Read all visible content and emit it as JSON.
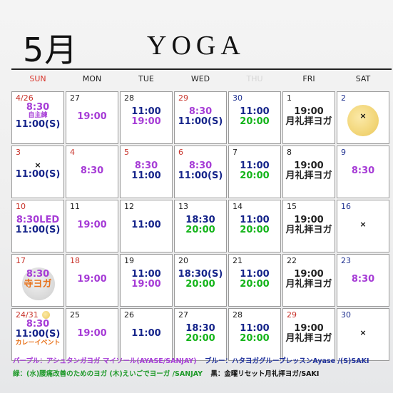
{
  "header": {
    "month": "5月",
    "title": "YOGA"
  },
  "weekdays": [
    "SUN",
    "MON",
    "TUE",
    "WED",
    "THU",
    "FRI",
    "SAT"
  ],
  "weeks": [
    [
      {
        "day": "4/26",
        "lines": [
          {
            "t": "8:30",
            "c": "purple"
          },
          {
            "t": "自主練",
            "c": "purple",
            "s": "small"
          },
          {
            "t": "11:00(S)",
            "c": "navy"
          }
        ]
      },
      {
        "day": "27",
        "lines": [
          {
            "t": "19:00",
            "c": "purple"
          }
        ]
      },
      {
        "day": "28",
        "lines": [
          {
            "t": "11:00",
            "c": "navy"
          },
          {
            "t": "19:00",
            "c": "purple"
          }
        ]
      },
      {
        "day": "29",
        "lines": [
          {
            "t": "8:30",
            "c": "purple"
          },
          {
            "t": "11:00(S)",
            "c": "navy"
          }
        ]
      },
      {
        "day": "30",
        "lines": [
          {
            "t": "11:00",
            "c": "navy"
          },
          {
            "t": "20:00",
            "c": "green"
          }
        ]
      },
      {
        "day": "1",
        "lines": [
          {
            "t": "19:00",
            "c": "black"
          },
          {
            "t": "月礼拝ヨガ",
            "c": "black"
          }
        ]
      },
      {
        "day": "2",
        "lines": [
          {
            "t": "×",
            "c": "black"
          }
        ]
      }
    ],
    [
      {
        "day": "3",
        "lines": [
          {
            "t": "×",
            "c": "black"
          },
          {
            "t": "11:00(S)",
            "c": "navy"
          }
        ]
      },
      {
        "day": "4",
        "lines": [
          {
            "t": "8:30",
            "c": "purple"
          }
        ]
      },
      {
        "day": "5",
        "lines": [
          {
            "t": "8:30",
            "c": "purple"
          },
          {
            "t": "11:00",
            "c": "navy"
          }
        ]
      },
      {
        "day": "6",
        "lines": [
          {
            "t": "8:30",
            "c": "purple"
          },
          {
            "t": "11:00(S)",
            "c": "navy"
          }
        ]
      },
      {
        "day": "7",
        "lines": [
          {
            "t": "11:00",
            "c": "navy"
          },
          {
            "t": "20:00",
            "c": "green"
          }
        ]
      },
      {
        "day": "8",
        "lines": [
          {
            "t": "19:00",
            "c": "black"
          },
          {
            "t": "月礼拝ヨガ",
            "c": "black"
          }
        ]
      },
      {
        "day": "9",
        "lines": [
          {
            "t": "8:30",
            "c": "purple"
          }
        ]
      }
    ],
    [
      {
        "day": "10",
        "lines": [
          {
            "t": "8:30LED",
            "c": "purple"
          },
          {
            "t": "11:00(S)",
            "c": "navy"
          }
        ]
      },
      {
        "day": "11",
        "lines": [
          {
            "t": "19:00",
            "c": "purple"
          }
        ]
      },
      {
        "day": "12",
        "lines": [
          {
            "t": "11:00",
            "c": "navy"
          }
        ]
      },
      {
        "day": "13",
        "lines": [
          {
            "t": "18:30",
            "c": "navy"
          },
          {
            "t": "20:00",
            "c": "green"
          }
        ]
      },
      {
        "day": "14",
        "lines": [
          {
            "t": "11:00",
            "c": "navy"
          },
          {
            "t": "20:00",
            "c": "green"
          }
        ]
      },
      {
        "day": "15",
        "lines": [
          {
            "t": "19:00",
            "c": "black"
          },
          {
            "t": "月礼拝ヨガ",
            "c": "black"
          }
        ]
      },
      {
        "day": "16",
        "lines": [
          {
            "t": "×",
            "c": "black"
          }
        ]
      }
    ],
    [
      {
        "day": "17",
        "lines": [
          {
            "t": "8:30",
            "c": "purple"
          },
          {
            "t": "寺ヨガ",
            "c": "orange"
          }
        ]
      },
      {
        "day": "18",
        "lines": [
          {
            "t": "19:00",
            "c": "purple"
          }
        ]
      },
      {
        "day": "19",
        "lines": [
          {
            "t": "11:00",
            "c": "navy"
          },
          {
            "t": "19:00",
            "c": "purple"
          }
        ]
      },
      {
        "day": "20",
        "lines": [
          {
            "t": "18:30(S)",
            "c": "navy"
          },
          {
            "t": "20:00",
            "c": "green"
          }
        ]
      },
      {
        "day": "21",
        "lines": [
          {
            "t": "11:00",
            "c": "navy"
          },
          {
            "t": "20:00",
            "c": "green"
          }
        ]
      },
      {
        "day": "22",
        "lines": [
          {
            "t": "19:00",
            "c": "black"
          },
          {
            "t": "月礼拝ヨガ",
            "c": "black"
          }
        ]
      },
      {
        "day": "23",
        "lines": [
          {
            "t": "8:30",
            "c": "purple"
          }
        ]
      }
    ],
    [
      {
        "day": "24/31",
        "lines": [
          {
            "t": "8:30",
            "c": "purple"
          },
          {
            "t": "11:00(S)",
            "c": "navy"
          },
          {
            "t": "カレーイベント",
            "c": "orange",
            "s": "small"
          }
        ]
      },
      {
        "day": "25",
        "lines": [
          {
            "t": "19:00",
            "c": "purple"
          }
        ]
      },
      {
        "day": "26",
        "lines": [
          {
            "t": "11:00",
            "c": "navy"
          }
        ]
      },
      {
        "day": "27",
        "lines": [
          {
            "t": "18:30",
            "c": "navy"
          },
          {
            "t": "20:00",
            "c": "green"
          }
        ]
      },
      {
        "day": "28",
        "lines": [
          {
            "t": "11:00",
            "c": "navy"
          },
          {
            "t": "20:00",
            "c": "green"
          }
        ]
      },
      {
        "day": "29",
        "lines": [
          {
            "t": "19:00",
            "c": "black"
          },
          {
            "t": "月礼拝ヨガ",
            "c": "black"
          }
        ]
      },
      {
        "day": "30",
        "lines": [
          {
            "t": "×",
            "c": "black"
          }
        ]
      }
    ]
  ],
  "legend": {
    "purple": "パープル：アシュタンガヨガ マイソール(AYASE/SANJAY)",
    "blue": "ブルー：ハタヨガグループレッスンAyase /(S)SAKI",
    "green": "緑：(水)腰痛改善のためのヨガ (木)えいごでヨーガ /SANJAY",
    "black": "黒：金曜リセット月礼拝ヨガ/SAKI"
  },
  "colors": {
    "purple": "#a63cd6",
    "navy": "#15248a",
    "green": "#14b41a",
    "black": "#222222",
    "orange": "#e8721b",
    "sunday": "#d9342b"
  }
}
